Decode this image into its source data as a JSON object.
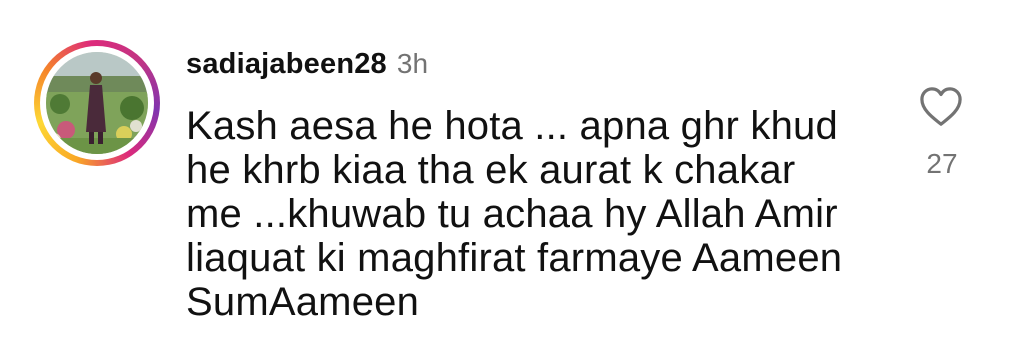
{
  "comment": {
    "username": "sadiajabeen28",
    "time": "3h",
    "lines": [
      "Kash aesa he hota ... apna ghr khud",
      "he khrb kiaa tha ek aurat k chakar",
      "me ...khuwab tu achaa hy Allah Amir",
      "liaquat ki maghfirat farmaye Aameen",
      "SumAameen"
    ],
    "likes": "27",
    "icons": {
      "like": "heart-outline-icon",
      "avatar": "story-ring-avatar"
    },
    "colors": {
      "text": "#111111",
      "secondary": "#737373",
      "ring_start": "#f9a825",
      "ring_end": "#c13584"
    }
  }
}
